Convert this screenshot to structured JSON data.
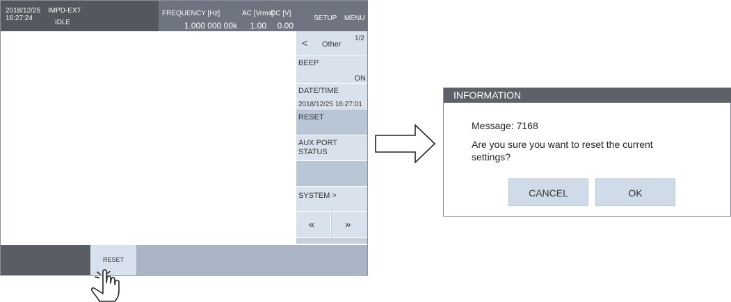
{
  "header": {
    "date": "2018/12/25",
    "time": "16:27:24",
    "mode": "IMPD-EXT",
    "state": "IDLE",
    "freq_label": "FREQUENCY [Hz]",
    "freq_value": "1.000 000 00k",
    "ac_label": "AC [Vrms]",
    "ac_value": "1.00",
    "dc_label": "DC [V]",
    "dc_value": "0.00",
    "setup": "SETUP",
    "menu": "MENU"
  },
  "side_menu": {
    "back_icon": "<",
    "title": "Other",
    "page": "1/2",
    "beep_label": "BEEP",
    "beep_value": "ON",
    "datetime_label": "DATE/TIME",
    "datetime_value": "2018/12/25 16:27:01",
    "reset": "RESET",
    "aux_line1": "AUX PORT",
    "aux_line2": "STATUS",
    "system": "SYSTEM >",
    "prev": "«",
    "next": "»"
  },
  "bottom": {
    "reset_key": "RESET"
  },
  "dialog": {
    "title": "INFORMATION",
    "message_line": "Message: 7168",
    "question_line1": "Are you sure you want to reset the current",
    "question_line2": "settings?",
    "cancel": "CANCEL",
    "ok": "OK"
  },
  "colors": {
    "header_dark": "#54575e",
    "panel_blue": "#d9e1ec",
    "button_blue": "#cfdbe9"
  }
}
